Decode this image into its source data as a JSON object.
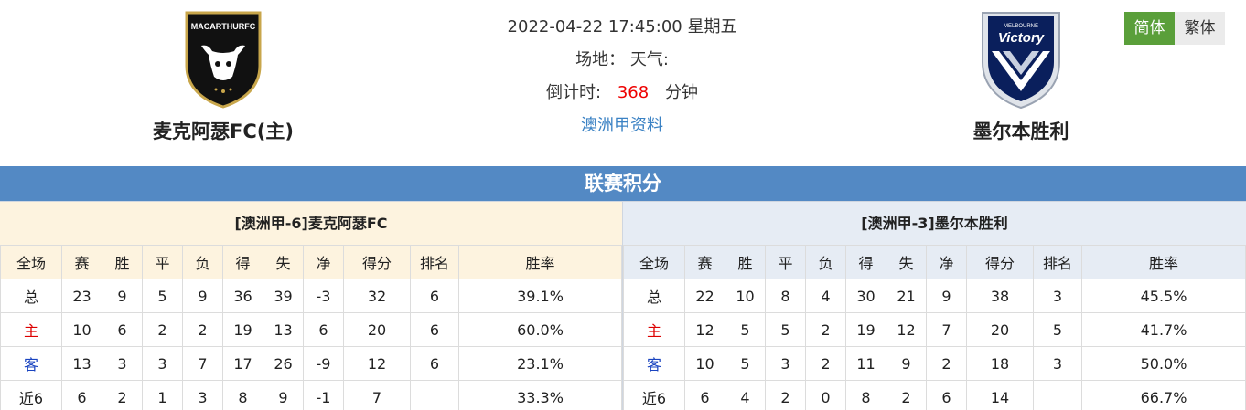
{
  "match": {
    "datetime": "2022-04-22 17:45:00 星期五",
    "venue_weather": "场地：  天气:",
    "countdown_label": "倒计时:",
    "countdown_value": "368",
    "countdown_unit": "分钟",
    "league_link": "澳洲甲资料"
  },
  "home_team": {
    "name": "麦克阿瑟FC(主)",
    "logo_text": "MACARTHURFC"
  },
  "away_team": {
    "name": "墨尔本胜利",
    "logo_text_top": "MELBOURNE",
    "logo_text": "Victory"
  },
  "lang": {
    "simplified": "简体",
    "traditional": "繁体"
  },
  "section_title": "联赛积分",
  "columns": [
    "全场",
    "赛",
    "胜",
    "平",
    "负",
    "得",
    "失",
    "净",
    "得分",
    "排名",
    "胜率"
  ],
  "home_table": {
    "title": "[澳洲甲-6]麦克阿瑟FC",
    "rows": [
      [
        "总",
        "23",
        "9",
        "5",
        "9",
        "36",
        "39",
        "-3",
        "32",
        "6",
        "39.1%"
      ],
      [
        "主",
        "10",
        "6",
        "2",
        "2",
        "19",
        "13",
        "6",
        "20",
        "6",
        "60.0%"
      ],
      [
        "客",
        "13",
        "3",
        "3",
        "7",
        "17",
        "26",
        "-9",
        "12",
        "6",
        "23.1%"
      ],
      [
        "近6",
        "6",
        "2",
        "1",
        "3",
        "8",
        "9",
        "-1",
        "7",
        "",
        "33.3%"
      ]
    ]
  },
  "away_table": {
    "title": "[澳洲甲-3]墨尔本胜利",
    "rows": [
      [
        "总",
        "22",
        "10",
        "8",
        "4",
        "30",
        "21",
        "9",
        "38",
        "3",
        "45.5%"
      ],
      [
        "主",
        "12",
        "5",
        "5",
        "2",
        "19",
        "12",
        "7",
        "20",
        "5",
        "41.7%"
      ],
      [
        "客",
        "10",
        "5",
        "3",
        "2",
        "11",
        "9",
        "2",
        "18",
        "3",
        "50.0%"
      ],
      [
        "近6",
        "6",
        "4",
        "2",
        "0",
        "8",
        "2",
        "6",
        "14",
        "",
        "66.7%"
      ]
    ]
  },
  "colors": {
    "section_bar": "#5389c4",
    "home_bg": "#fdf3df",
    "away_bg": "#e6ecf4",
    "countdown": "#e00000",
    "lang_active": "#5a9f3a"
  }
}
